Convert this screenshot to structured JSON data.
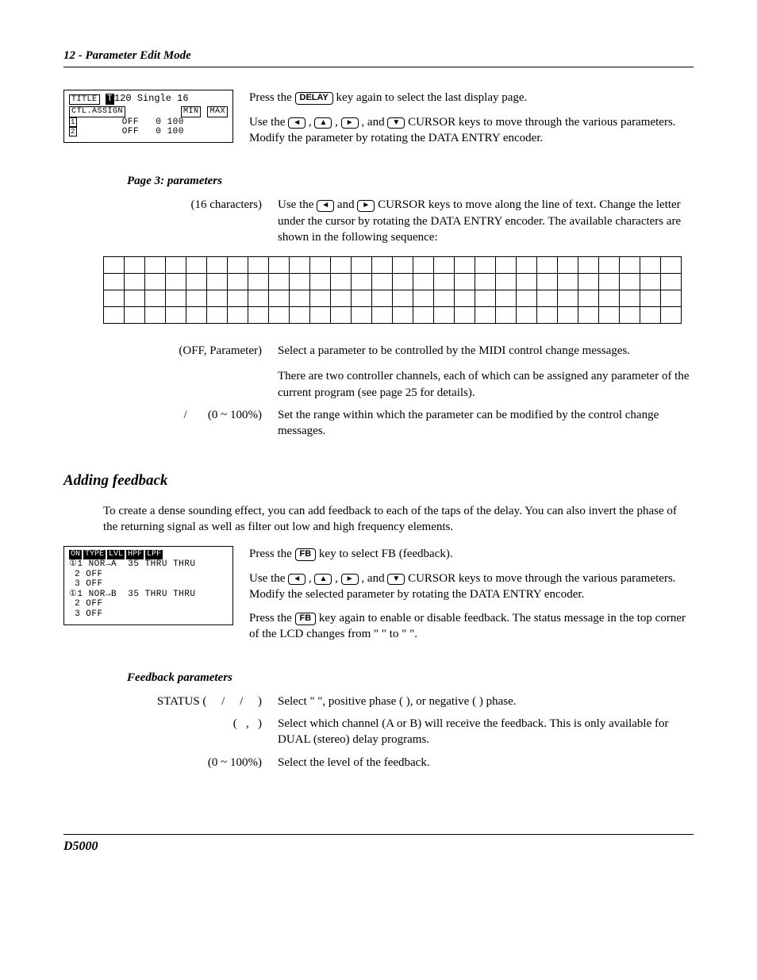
{
  "header": "12 - Parameter Edit Mode",
  "footer": "D5000",
  "lcd1": {
    "title_label": "TITLE",
    "title_value": "T120 Single 16",
    "ctl_label": "CTL.ASSIGN",
    "min_label": "MIN",
    "max_label": "MAX",
    "row1_idx": "1",
    "row1_assign": "OFF",
    "row1_min": "0",
    "row1_max": "100",
    "row2_idx": "2",
    "row2_assign": "OFF",
    "row2_min": "0",
    "row2_max": "100"
  },
  "top_block": {
    "p1_a": "Press the ",
    "p1_key": "DELAY",
    "p1_b": " key again to select the last display page.",
    "p2_a": "Use the ",
    "p2_b": " , ",
    "p2_c": " , ",
    "p2_d": " , and ",
    "p2_e": " CURSOR keys to move through the various parameters. Modify the parameter by rotating the DATA ENTRY encoder."
  },
  "page3_heading": "Page 3: parameters",
  "param1": {
    "left": "(16 characters)",
    "right_a": "Use the ",
    "right_b": " and ",
    "right_c": " CURSOR keys to move along the line of text. Change the letter under the cursor by rotating the DATA ENTRY encoder. The available characters are shown in the following sequence:"
  },
  "grid": {
    "rows": 4,
    "cols": 28
  },
  "param2": {
    "left": "              (OFF, Parameter)",
    "right1": "Select a parameter to be controlled by the MIDI control change messages.",
    "right2": "There are two controller channels, each of which can be assigned any parameter of the current program (see page 25 for details)."
  },
  "param3": {
    "left": "   /       (0 ~ 100%)",
    "right": "Set the range within which the parameter can be modified by the control change messages."
  },
  "feedback_heading": "Adding feedback",
  "feedback_intro": "To create a dense sounding effect, you can add feedback to each of the taps of the delay. You can also invert the phase of the returning signal as well as filter out low and high frequency elements.",
  "lcd2": {
    "hdr_on": "ON",
    "hdr_type": "TYPE",
    "hdr_lvl": "LVL",
    "hdr_hpf": "HPF",
    "hdr_lpf": "LPF",
    "r1": "①1 NOR→A  35 THRU THRU",
    "r2": " 2 OFF",
    "r3": " 3 OFF",
    "r4": "①1 NOR→B  35 THRU THRU",
    "r5": " 2 OFF",
    "r6": " 3 OFF"
  },
  "fb_block": {
    "p1_a": "Press the ",
    "p1_key": "FB",
    "p1_b": " key to select FB (feedback).",
    "p2_a": "Use the ",
    "p2_b": " , ",
    "p2_c": " , ",
    "p2_d": " , and ",
    "p2_e": " CURSOR keys to move through the various parameters. Modify the selected parameter by rotating the DATA ENTRY encoder.",
    "p3_a": "Press the ",
    "p3_key": "FB",
    "p3_b": " key again to enable or disable feedback. The status message in the top corner of the LCD changes from \"    \" to \"      \"."
  },
  "fb_params_heading": "Feedback parameters",
  "fbp1": {
    "left": "STATUS (     /     /     )",
    "right": "Select \"     \", positive phase (       ), or negative (       ) phase."
  },
  "fbp2": {
    "left": "(   ,   )",
    "right": "Select which channel (A or B) will receive the feedback. This is only available for DUAL (stereo) delay programs."
  },
  "fbp3": {
    "left": "(0 ~ 100%)",
    "right": "Select the level of the feedback."
  },
  "arrows": {
    "left": "◄",
    "up": "▲",
    "right": "►",
    "down": "▼"
  }
}
